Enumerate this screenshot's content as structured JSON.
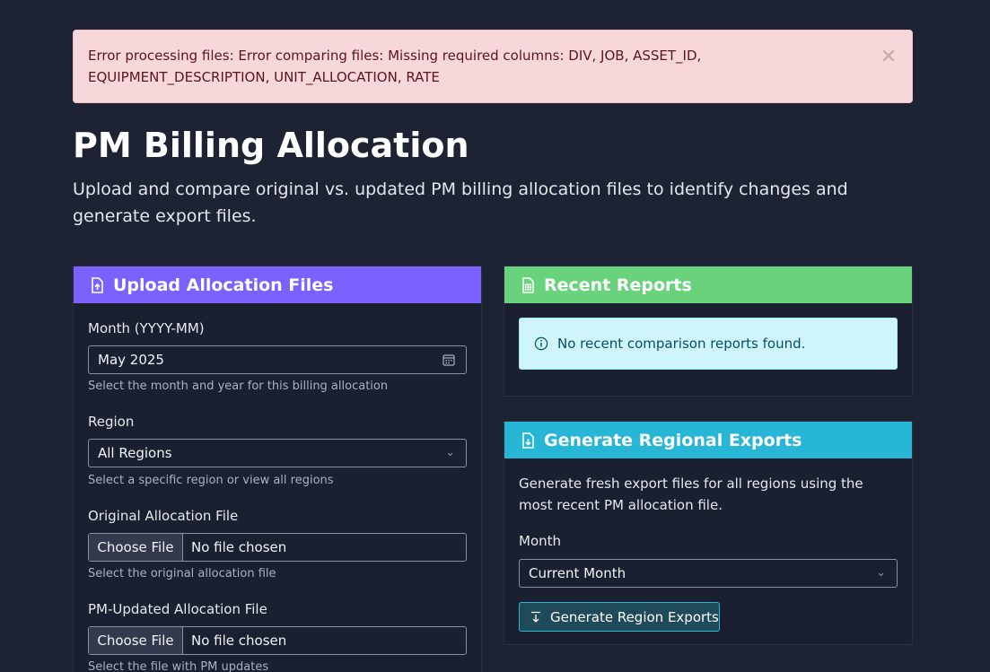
{
  "alert": {
    "message": "Error processing files: Error comparing files: Missing required columns: DIV, JOB, ASSET_ID, EQUIPMENT_DESCRIPTION, UNIT_ALLOCATION, RATE",
    "close_icon": "close-icon",
    "color": "#f8d7da"
  },
  "page": {
    "title": "PM Billing Allocation",
    "subtitle": "Upload and compare original vs. updated PM billing allocation files to identify changes and generate export files."
  },
  "upload": {
    "header": "Upload Allocation Files",
    "header_icon": "file-upload-icon",
    "header_color": "#7b61ff",
    "month": {
      "label": "Month (YYYY-MM)",
      "value": "May 2025",
      "icon": "calendar-icon",
      "help": "Select the month and year for this billing allocation"
    },
    "region": {
      "label": "Region",
      "value": "All Regions",
      "icon": "chevron-down-icon",
      "help": "Select a specific region or view all regions"
    },
    "original": {
      "label": "Original Allocation File",
      "button": "Choose File",
      "status": "No file chosen",
      "help": "Select the original allocation file"
    },
    "updated": {
      "label": "PM-Updated Allocation File",
      "button": "Choose File",
      "status": "No file chosen",
      "help": "Select the file with PM updates"
    }
  },
  "recent": {
    "header": "Recent Reports",
    "header_icon": "spreadsheet-icon",
    "header_color": "#69d27c",
    "info_icon": "info-icon",
    "empty_message": "No recent comparison reports found."
  },
  "exports": {
    "header": "Generate Regional Exports",
    "header_icon": "file-download-icon",
    "header_color": "#27b6d6",
    "description": "Generate fresh export files for all regions using the most recent PM allocation file.",
    "month_label": "Month",
    "month_value": "Current Month",
    "month_icon": "chevron-down-icon",
    "button": "Generate Region Exports",
    "button_icon": "download-icon"
  }
}
